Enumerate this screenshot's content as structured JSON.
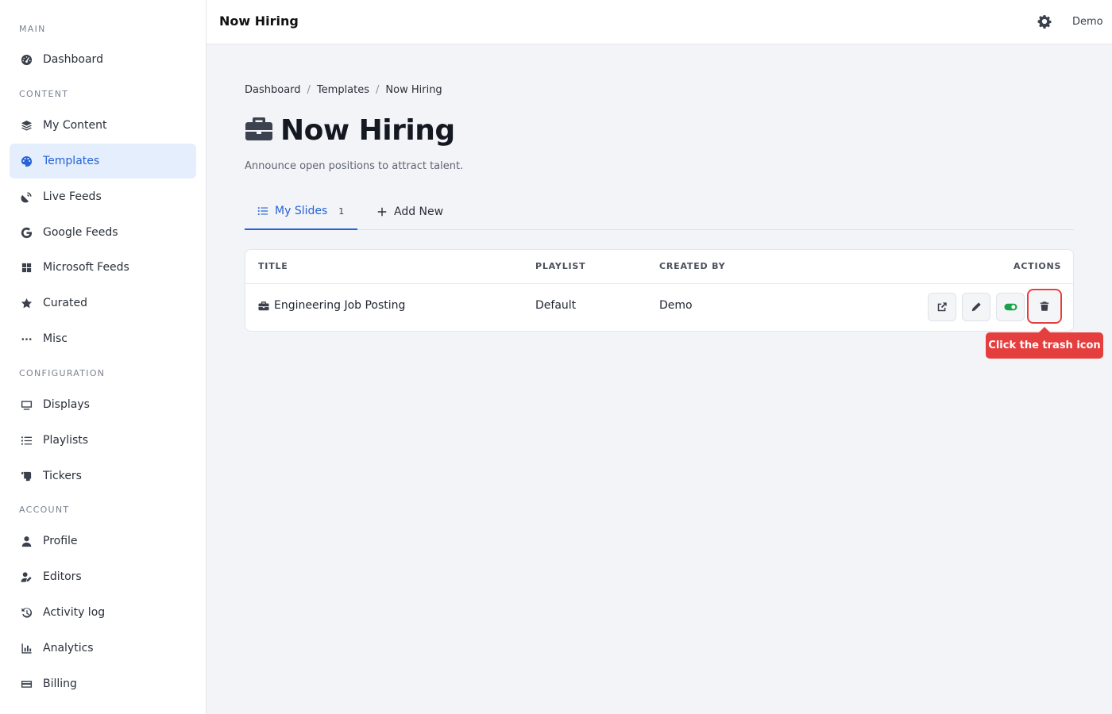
{
  "sidebar": {
    "sections": [
      {
        "label": "MAIN"
      },
      {
        "label": "CONTENT"
      },
      {
        "label": "CONFIGURATION"
      },
      {
        "label": "ACCOUNT"
      }
    ],
    "items": [
      {
        "label": "Dashboard",
        "icon": "dashboard-icon"
      },
      {
        "label": "My Content",
        "icon": "layers-icon"
      },
      {
        "label": "Templates",
        "icon": "palette-icon",
        "active": true
      },
      {
        "label": "Live Feeds",
        "icon": "satellite-dish-icon"
      },
      {
        "label": "Google Feeds",
        "icon": "google-icon"
      },
      {
        "label": "Microsoft Feeds",
        "icon": "microsoft-icon"
      },
      {
        "label": "Curated",
        "icon": "star-icon"
      },
      {
        "label": "Misc",
        "icon": "ellipsis-icon"
      },
      {
        "label": "Displays",
        "icon": "monitor-icon"
      },
      {
        "label": "Playlists",
        "icon": "list-icon"
      },
      {
        "label": "Tickers",
        "icon": "scroll-icon"
      },
      {
        "label": "Profile",
        "icon": "user-icon"
      },
      {
        "label": "Editors",
        "icon": "user-edit-icon"
      },
      {
        "label": "Activity log",
        "icon": "history-icon"
      },
      {
        "label": "Analytics",
        "icon": "chart-icon"
      },
      {
        "label": "Billing",
        "icon": "credit-card-icon"
      }
    ]
  },
  "header": {
    "title": "Now Hiring",
    "user": "Demo",
    "settings_icon": "gear-icon"
  },
  "breadcrumb": [
    "Dashboard",
    "Templates",
    "Now Hiring"
  ],
  "page": {
    "title": "Now Hiring",
    "subtitle": "Announce open positions to attract talent.",
    "title_icon": "briefcase-icon"
  },
  "tabs": [
    {
      "label": "My Slides",
      "count": "1",
      "active": true
    },
    {
      "label": "Add New",
      "active": false
    }
  ],
  "table": {
    "headers": [
      "TITLE",
      "PLAYLIST",
      "CREATED BY",
      "ACTIONS"
    ],
    "rows": [
      {
        "title": "Engineering Job Posting",
        "playlist": "Default",
        "created_by": "Demo"
      }
    ]
  },
  "tooltip": "Click the trash icon",
  "colors": {
    "accent": "#2563d6",
    "active_bg": "#e4eefc",
    "highlight": "#e53e3e",
    "toggle": "#18a34a"
  }
}
